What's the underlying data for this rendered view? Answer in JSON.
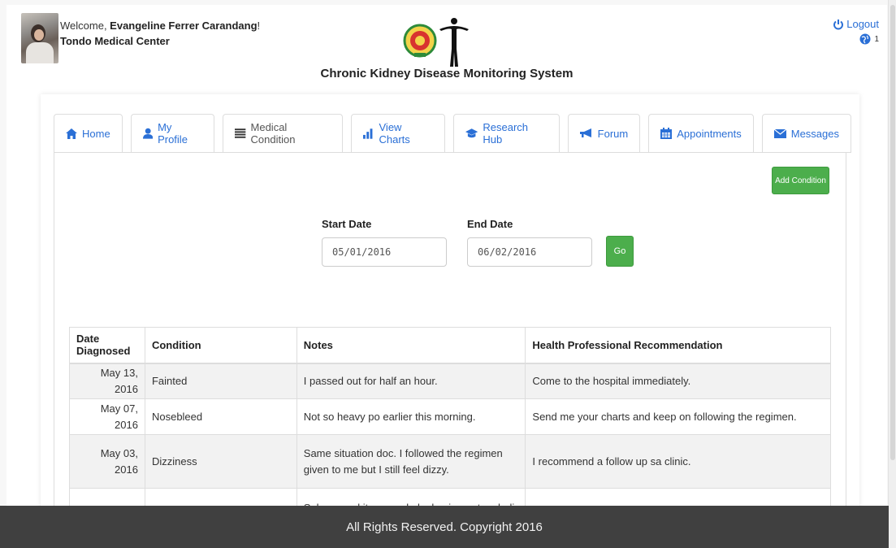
{
  "header": {
    "welcome_prefix": "Welcome, ",
    "user_name": "Evangeline Ferrer Carandang",
    "welcome_suffix": "!",
    "hospital": "Tondo Medical Center",
    "app_title": "Chronic Kidney Disease Monitoring System",
    "logout_label": "Logout",
    "notification_count": "1"
  },
  "tabs": [
    {
      "label": "Home",
      "icon": "home-icon"
    },
    {
      "label": "My Profile",
      "icon": "user-icon"
    },
    {
      "label": "Medical Condition",
      "icon": "list-icon",
      "active": true
    },
    {
      "label": "View Charts",
      "icon": "bar-chart-icon"
    },
    {
      "label": "Research Hub",
      "icon": "graduation-cap-icon"
    },
    {
      "label": "Forum",
      "icon": "bullhorn-icon"
    },
    {
      "label": "Appointments",
      "icon": "calendar-icon"
    },
    {
      "label": "Messages",
      "icon": "envelope-icon"
    }
  ],
  "filter": {
    "add_condition_label": "Add Condition",
    "start_date_label": "Start Date",
    "start_date_value": "05/01/2016",
    "end_date_label": "End Date",
    "end_date_value": "06/02/2016",
    "go_label": "Go"
  },
  "table": {
    "headers": [
      "Date Diagnosed",
      "Condition",
      "Notes",
      "Health Professional Recommendation"
    ],
    "rows": [
      {
        "date": "May 13, 2016",
        "condition": "Fainted",
        "notes": "I passed out for half an hour.",
        "recommendation": "Come to the hospital immediately."
      },
      {
        "date": "May 07, 2016",
        "condition": "Nosebleed",
        "notes": "Not so heavy po earlier this morning.",
        "recommendation": "Send me your charts and keep on following the regimen."
      },
      {
        "date": "May 03, 2016",
        "condition": "Dizziness",
        "notes": "Same situation doc. I followed the regimen given to me but I still feel dizzy.",
        "recommendation": "I recommend a follow up sa clinic."
      },
      {
        "date": "",
        "condition": "",
        "notes": "Sobrang sakit po ng ulo ko kaninang tanghali. Medyo",
        "recommendation": ""
      }
    ]
  },
  "footer": {
    "text": "All Rights Reserved. Copyright 2016"
  },
  "colors": {
    "accent": "#2a6fd6",
    "success": "#4cae4c",
    "footer_bg": "#404040"
  }
}
